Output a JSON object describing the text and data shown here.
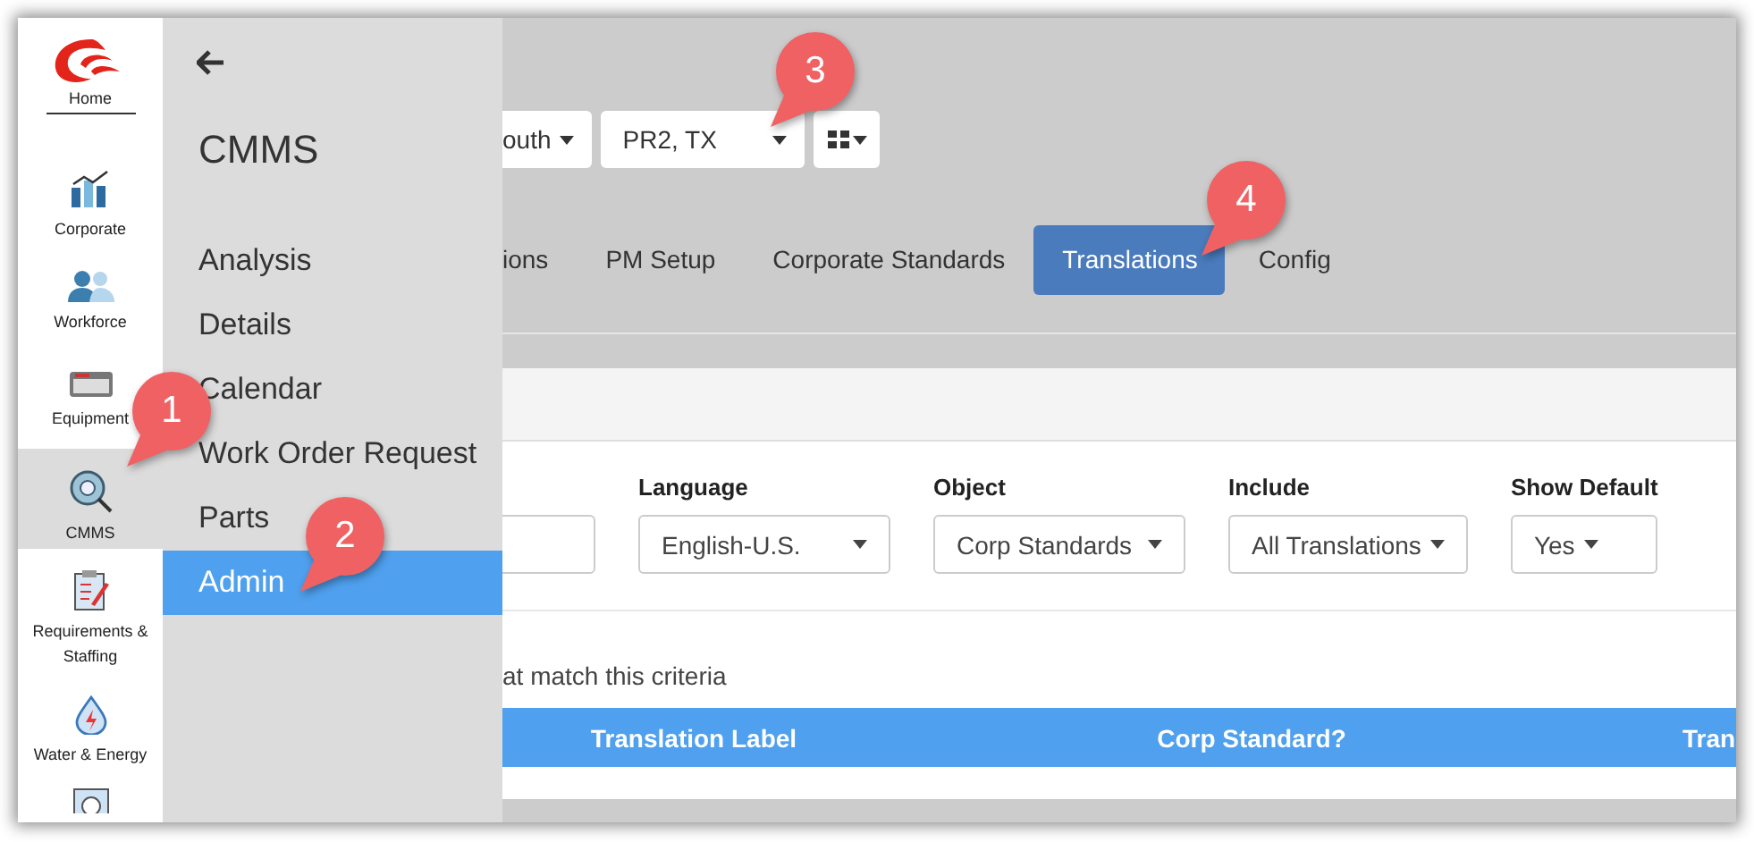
{
  "rail": {
    "home_label": "Home",
    "items": [
      {
        "label": "Corporate",
        "selected": false
      },
      {
        "label": "Workforce",
        "selected": false
      },
      {
        "label": "Equipment",
        "selected": false
      },
      {
        "label": "CMMS",
        "selected": true
      },
      {
        "label": "Requirements & Staffing",
        "selected": false
      },
      {
        "label": "Water & Energy",
        "selected": false
      }
    ]
  },
  "flyout": {
    "title": "CMMS",
    "items": [
      {
        "label": "Analysis",
        "selected": false
      },
      {
        "label": "Details",
        "selected": false
      },
      {
        "label": "Calendar",
        "selected": false
      },
      {
        "label": "Work Order Request",
        "selected": false
      },
      {
        "label": "Parts",
        "selected": false
      },
      {
        "label": "Admin",
        "selected": true
      }
    ]
  },
  "toolbar": {
    "dropdowns": [
      {
        "value": "outh",
        "kind": "inline"
      },
      {
        "value": "PR2, TX",
        "kind": "wide"
      }
    ]
  },
  "tabs": [
    {
      "label": "ions",
      "selected": false
    },
    {
      "label": "PM Setup",
      "selected": false
    },
    {
      "label": "Corporate Standards",
      "selected": false
    },
    {
      "label": "Translations",
      "selected": true
    },
    {
      "label": "Config",
      "selected": false
    }
  ],
  "filters": [
    {
      "kind": "input"
    },
    {
      "kind": "wide",
      "label": "Language",
      "value": "English-U.S."
    },
    {
      "kind": "wide",
      "label": "Object",
      "value": "Corp Standards"
    },
    {
      "kind": "inline",
      "label": "Include",
      "value": "All Translations"
    },
    {
      "kind": "inline",
      "label": "Show Default",
      "value": "Yes"
    }
  ],
  "results_text": "at match this criteria",
  "table": {
    "columns": [
      "Translation Label",
      "Corp Standard?",
      "Tran"
    ]
  },
  "markers": [
    {
      "number": "1"
    },
    {
      "number": "2"
    },
    {
      "number": "3"
    },
    {
      "number": "4"
    }
  ]
}
